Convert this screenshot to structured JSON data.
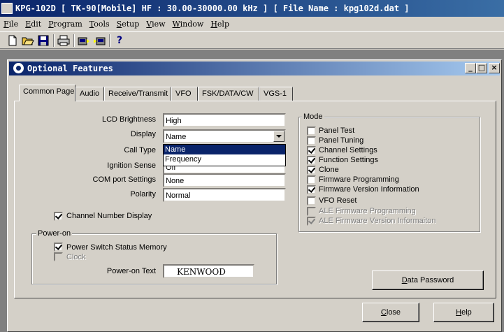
{
  "window": {
    "title": "KPG-102D  [ TK-90[Mobile]  HF : 30.00-30000.00 kHz ] [ File Name : kpg102d.dat ]"
  },
  "menu": [
    "File",
    "Edit",
    "Program",
    "Tools",
    "Setup",
    "View",
    "Window",
    "Help"
  ],
  "toolbar": {
    "icons": [
      "new-file-icon",
      "open-folder-icon",
      "save-icon",
      "print-icon",
      "read-radio-icon",
      "write-radio-icon",
      "help-icon"
    ],
    "help_glyph": "?"
  },
  "dialog": {
    "title": "Optional Features",
    "caption_buttons": {
      "minimize": "_",
      "maximize": "□",
      "close": "×"
    },
    "tabs": [
      "Common Page",
      "Audio",
      "Receive/Transmit",
      "VFO",
      "FSK/DATA/CW",
      "VGS-1"
    ],
    "active_tab": "Common Page",
    "fields": {
      "lcd_brightness": {
        "label": "LCD Brightness",
        "value": "High"
      },
      "display": {
        "label": "Display",
        "value": "Name",
        "options": [
          "Name",
          "Frequency"
        ]
      },
      "call_type": {
        "label": "Call Type"
      },
      "ignition_sense": {
        "label": "Ignition Sense",
        "value": "Off"
      },
      "com_port": {
        "label": "COM port Settings",
        "value": "None"
      },
      "polarity": {
        "label": "Polarity",
        "value": "Normal"
      }
    },
    "channel_number_display": {
      "label": "Channel Number Display",
      "checked": true
    },
    "power_on": {
      "title": "Power-on",
      "power_switch_memory": {
        "label": "Power Switch Status Memory",
        "checked": true
      },
      "clock": {
        "label": "Clock",
        "checked": false,
        "disabled": true
      },
      "text_label": "Power-on Text",
      "text_value": "KENWOOD"
    },
    "mode": {
      "title": "Mode",
      "items": [
        {
          "label": "Panel Test",
          "checked": false,
          "disabled": false
        },
        {
          "label": "Panel Tuning",
          "checked": false,
          "disabled": false
        },
        {
          "label": "Channel Settings",
          "checked": true,
          "disabled": false
        },
        {
          "label": "Function Settings",
          "checked": true,
          "disabled": false
        },
        {
          "label": "Clone",
          "checked": true,
          "disabled": false
        },
        {
          "label": "Firmware Programming",
          "checked": false,
          "disabled": false
        },
        {
          "label": "Firmware Version Information",
          "checked": true,
          "disabled": false
        },
        {
          "label": "VFO Reset",
          "checked": false,
          "disabled": false
        },
        {
          "label": "ALE Firmware Programming",
          "checked": false,
          "disabled": true
        },
        {
          "label": "ALE Firmware Version Informaiton",
          "checked": true,
          "disabled": true
        }
      ]
    },
    "buttons": {
      "data_password": "Data Password",
      "close": "Close",
      "help": "Help"
    }
  }
}
